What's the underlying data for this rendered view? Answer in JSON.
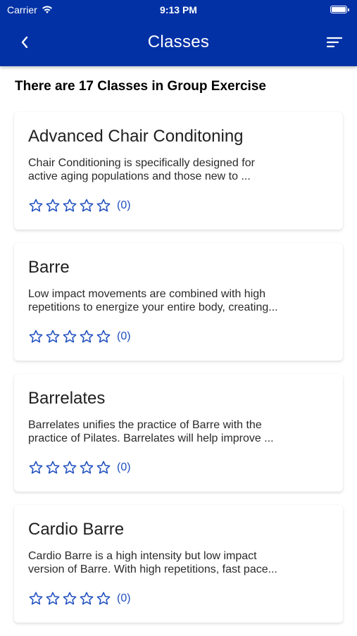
{
  "status": {
    "carrier": "Carrier",
    "time": "9:13 PM"
  },
  "nav": {
    "title": "Classes"
  },
  "count_text": "There are 17 Classes in Group Exercise",
  "classes": [
    {
      "name": "Advanced Chair Conditoning",
      "desc_line1": "Chair Conditioning is specifically designed for",
      "desc_line2": "active aging populations and those new to ...",
      "rating_count": "(0)"
    },
    {
      "name": "Barre",
      "desc_line1": "Low impact movements are combined with high",
      "desc_line2": "repetitions to energize your entire body, creating...",
      "rating_count": "(0)"
    },
    {
      "name": "Barrelates",
      "desc_line1": "Barrelates unifies the practice of Barre with the",
      "desc_line2": "practice of Pilates. Barrelates will help improve ...",
      "rating_count": "(0)"
    },
    {
      "name": "Cardio Barre",
      "desc_line1": "Cardio Barre is a high intensity but low impact",
      "desc_line2": "version of Barre. With high repetitions, fast pace...",
      "rating_count": "(0)"
    }
  ],
  "colors": {
    "header": "#0231a6",
    "star": "#1f4fbf"
  },
  "icons": [
    "back-chevron-icon",
    "filter-sort-icon",
    "wifi-icon",
    "battery-icon",
    "star-outline-icon"
  ]
}
